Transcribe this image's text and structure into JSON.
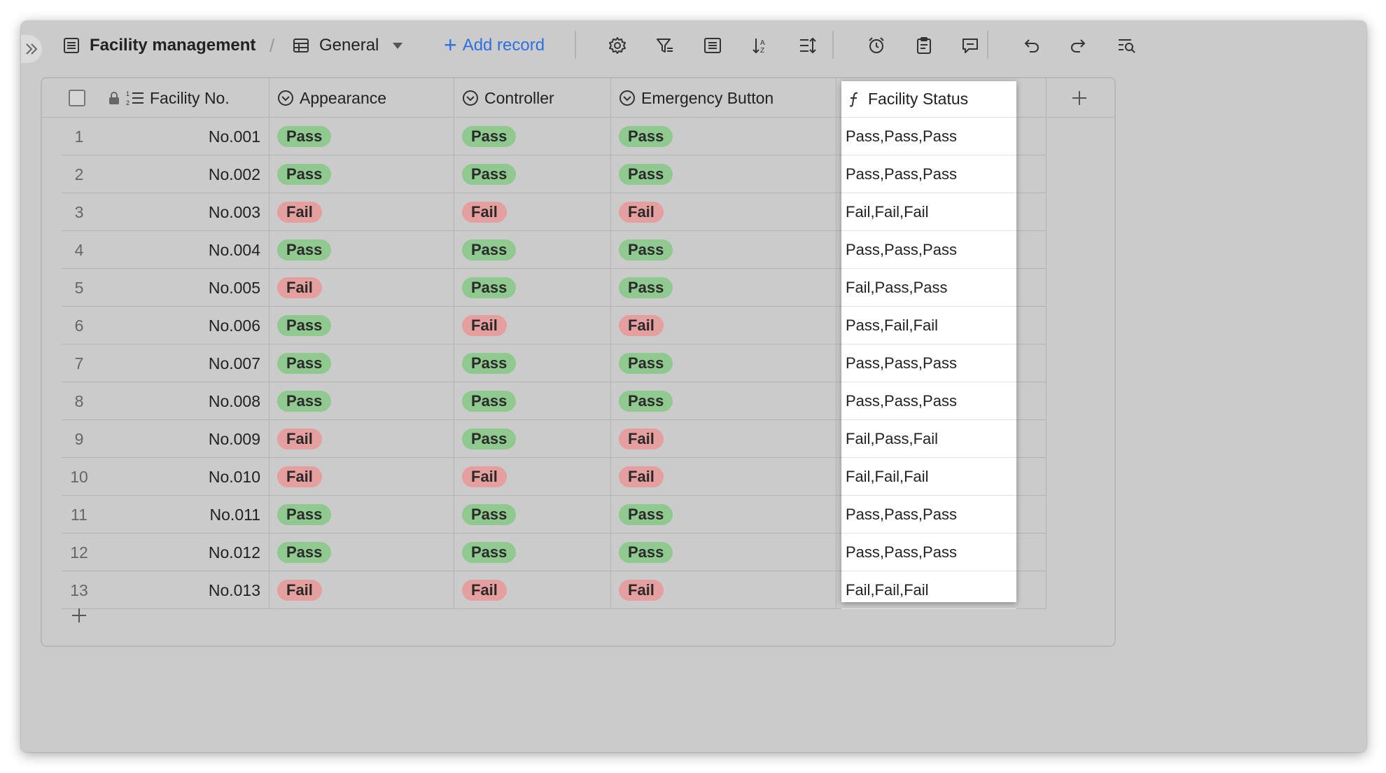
{
  "toolbar": {
    "title": "Facility management",
    "view_name": "General",
    "add_record": "Add record"
  },
  "icons": {
    "expand": "double-chevron-right-icon",
    "table": "table-icon",
    "grid_view": "grid-view-icon",
    "settings": "gear-icon",
    "filter": "filter-icon",
    "group": "group-icon",
    "sort": "sort-icon",
    "row_height": "row-height-icon",
    "reminder": "alarm-clock-icon",
    "form": "clipboard-icon",
    "comment": "comment-icon",
    "undo": "undo-icon",
    "redo": "redo-icon",
    "search": "search-icon"
  },
  "columns": {
    "facility_no": "Facility No.",
    "appearance": "Appearance",
    "controller": "Controller",
    "emergency": "Emergency Button",
    "status": "Facility Status"
  },
  "rows": [
    {
      "num": "1",
      "no": "No.001",
      "appearance": "Pass",
      "controller": "Pass",
      "emergency": "Pass",
      "status": "Pass,Pass,Pass"
    },
    {
      "num": "2",
      "no": "No.002",
      "appearance": "Pass",
      "controller": "Pass",
      "emergency": "Pass",
      "status": "Pass,Pass,Pass"
    },
    {
      "num": "3",
      "no": "No.003",
      "appearance": "Fail",
      "controller": "Fail",
      "emergency": "Fail",
      "status": "Fail,Fail,Fail"
    },
    {
      "num": "4",
      "no": "No.004",
      "appearance": "Pass",
      "controller": "Pass",
      "emergency": "Pass",
      "status": "Pass,Pass,Pass"
    },
    {
      "num": "5",
      "no": "No.005",
      "appearance": "Fail",
      "controller": "Pass",
      "emergency": "Pass",
      "status": "Fail,Pass,Pass"
    },
    {
      "num": "6",
      "no": "No.006",
      "appearance": "Pass",
      "controller": "Fail",
      "emergency": "Fail",
      "status": "Pass,Fail,Fail"
    },
    {
      "num": "7",
      "no": "No.007",
      "appearance": "Pass",
      "controller": "Pass",
      "emergency": "Pass",
      "status": "Pass,Pass,Pass"
    },
    {
      "num": "8",
      "no": "No.008",
      "appearance": "Pass",
      "controller": "Pass",
      "emergency": "Pass",
      "status": "Pass,Pass,Pass"
    },
    {
      "num": "9",
      "no": "No.009",
      "appearance": "Fail",
      "controller": "Pass",
      "emergency": "Fail",
      "status": "Fail,Pass,Fail"
    },
    {
      "num": "10",
      "no": "No.010",
      "appearance": "Fail",
      "controller": "Fail",
      "emergency": "Fail",
      "status": "Fail,Fail,Fail"
    },
    {
      "num": "11",
      "no": "No.011",
      "appearance": "Pass",
      "controller": "Pass",
      "emergency": "Pass",
      "status": "Pass,Pass,Pass"
    },
    {
      "num": "12",
      "no": "No.012",
      "appearance": "Pass",
      "controller": "Pass",
      "emergency": "Pass",
      "status": "Pass,Pass,Pass"
    },
    {
      "num": "13",
      "no": "No.013",
      "appearance": "Fail",
      "controller": "Fail",
      "emergency": "Fail",
      "status": "Fail,Fail,Fail"
    }
  ],
  "colors": {
    "pass": "#8fc98f",
    "fail": "#e59f9f",
    "accent": "#2f6fe4"
  }
}
